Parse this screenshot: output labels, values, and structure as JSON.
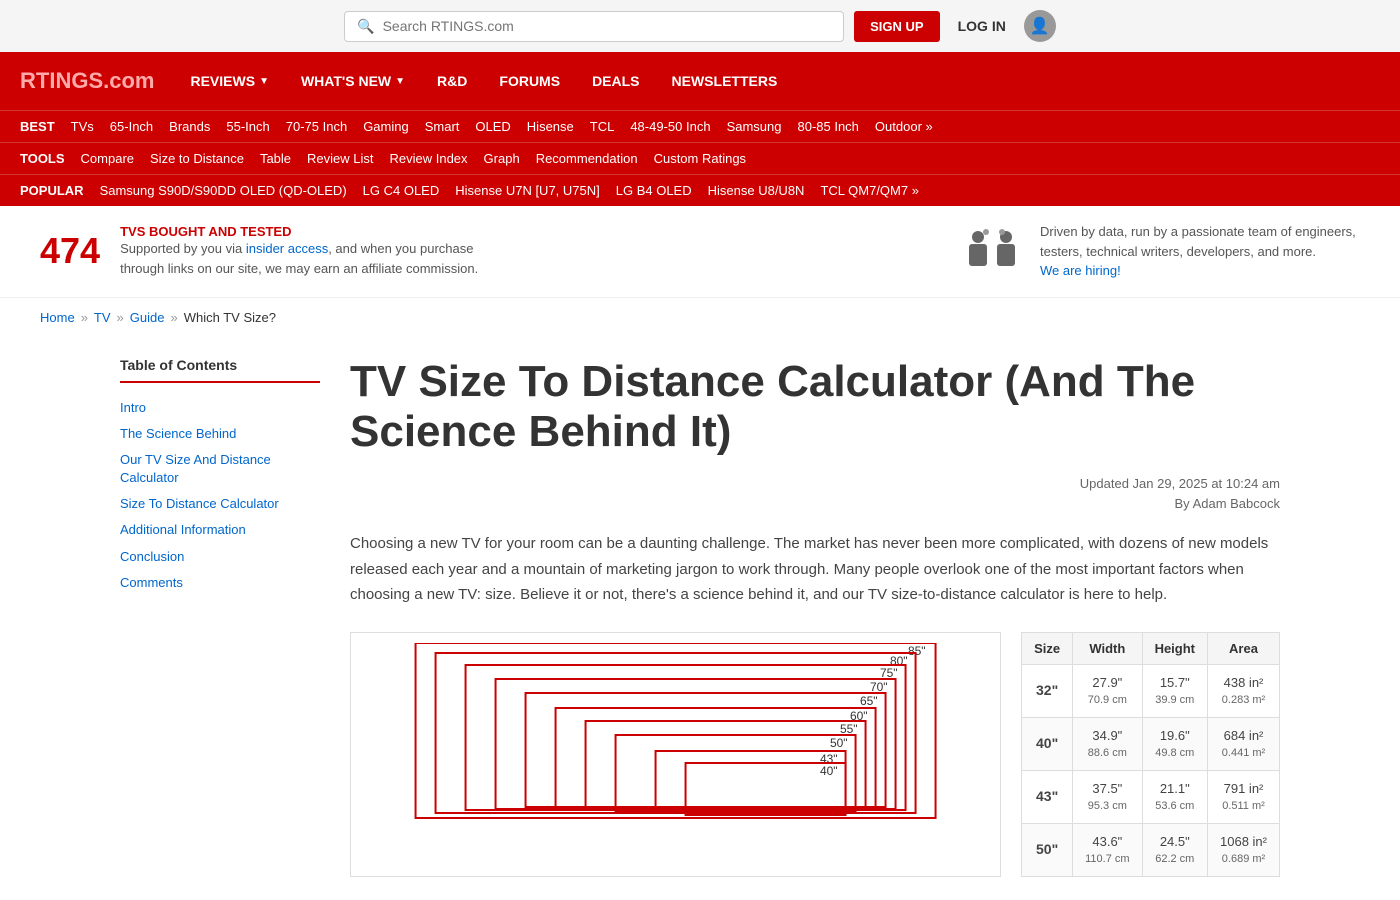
{
  "search": {
    "placeholder": "Search RTINGS.com"
  },
  "header": {
    "sign_up": "SIGN UP",
    "log_in": "LOG IN"
  },
  "logo": {
    "text": "RTINGS",
    "suffix": ".com"
  },
  "main_nav": {
    "items": [
      {
        "label": "REVIEWS",
        "has_arrow": true
      },
      {
        "label": "WHAT'S NEW",
        "has_arrow": true
      },
      {
        "label": "R&D",
        "has_arrow": false
      },
      {
        "label": "FORUMS",
        "has_arrow": false
      },
      {
        "label": "DEALS",
        "has_arrow": false
      },
      {
        "label": "NEWSLETTERS",
        "has_arrow": false
      }
    ]
  },
  "best_nav": {
    "label": "BEST",
    "items": [
      "TVs",
      "65-Inch",
      "Brands",
      "55-Inch",
      "70-75 Inch",
      "Gaming",
      "Smart",
      "OLED",
      "Hisense",
      "TCL",
      "48-49-50 Inch",
      "Samsung",
      "80-85 Inch",
      "Outdoor »"
    ]
  },
  "tools_nav": {
    "label": "TOOLS",
    "items": [
      "Compare",
      "Size to Distance",
      "Table",
      "Review List",
      "Review Index",
      "Graph",
      "Recommendation",
      "Custom Ratings"
    ]
  },
  "popular_nav": {
    "label": "POPULAR",
    "items": [
      "Samsung S90D/S90DD OLED (QD-OLED)",
      "LG C4 OLED",
      "Hisense U7N [U7, U75N]",
      "LG B4 OLED",
      "Hisense U8/U8N",
      "TCL QM7/QM7 »"
    ]
  },
  "banner": {
    "count": "474",
    "title": "TVS BOUGHT AND TESTED",
    "description": "Supported by you via insider access, and when you purchase through links on our site, we may earn an affiliate commission.",
    "insider_link_text": "insider access",
    "right_text": "Driven by data, run by a passionate team of engineers, testers, technical writers, developers, and more.",
    "hiring_text": "We are hiring!"
  },
  "breadcrumb": {
    "items": [
      "Home",
      "TV",
      "Guide"
    ],
    "current": "Which TV Size?"
  },
  "page_title": "TV Size To Distance Calculator (And The Science Behind It)",
  "update_info": {
    "updated": "Updated Jan 29, 2025 at 10:24 am",
    "author": "By Adam Babcock"
  },
  "intro": "Choosing a new TV for your room can be a daunting challenge. The market has never been more complicated, with dozens of new models released each year and a mountain of marketing jargon to work through. Many people overlook one of the most important factors when choosing a new TV: size. Believe it or not, there's a science behind it, and our TV size-to-distance calculator is here to help.",
  "toc": {
    "title": "Table of Contents",
    "items": [
      "Intro",
      "The Science Behind",
      "Our TV Size And Distance Calculator",
      "Size To Distance Calculator",
      "Additional Information",
      "Conclusion",
      "Comments"
    ]
  },
  "tv_sizes_chart": {
    "labels": [
      "85\"",
      "80\"",
      "75\"",
      "70\"",
      "65\"",
      "60\"",
      "55\"",
      "50\"",
      "43\"",
      "40\""
    ]
  },
  "sizes_table": {
    "headers": [
      "Size",
      "Width",
      "Height",
      "Area"
    ],
    "rows": [
      {
        "size": "32\"",
        "width_in": "27.9\"",
        "width_cm": "70.9 cm",
        "height_in": "15.7\"",
        "height_cm": "39.9 cm",
        "area_in": "438 in²",
        "area_m": "0.283 m²"
      },
      {
        "size": "40\"",
        "width_in": "34.9\"",
        "width_cm": "88.6 cm",
        "height_in": "19.6\"",
        "height_cm": "49.8 cm",
        "area_in": "684 in²",
        "area_m": "0.441 m²"
      },
      {
        "size": "43\"",
        "width_in": "37.5\"",
        "width_cm": "95.3 cm",
        "height_in": "21.1\"",
        "height_cm": "53.6 cm",
        "area_in": "791 in²",
        "area_m": "0.511 m²"
      },
      {
        "size": "50\"",
        "width_in": "43.6\"",
        "width_cm": "110.7 cm",
        "height_in": "24.5\"",
        "height_cm": "62.2 cm",
        "area_in": "1068 in²",
        "area_m": "0.689 m²"
      }
    ]
  }
}
